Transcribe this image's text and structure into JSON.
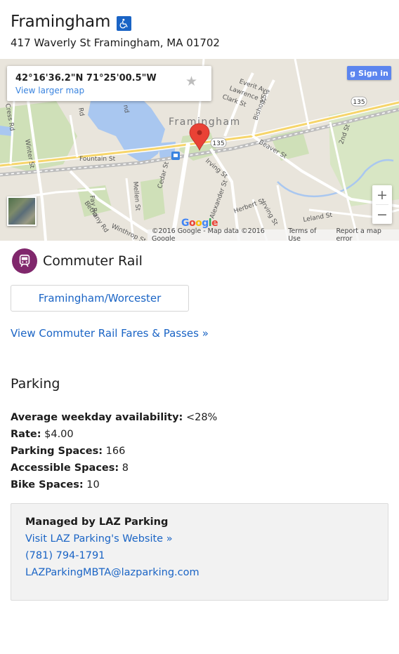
{
  "header": {
    "title": "Framingham",
    "address": "417 Waverly St Framingham, MA 01702"
  },
  "map": {
    "coordinates": "42°16'36.2\"N 71°25'00.5\"W",
    "view_larger": "View larger map",
    "sign_in": "Sign in",
    "zoom_in": "+",
    "zoom_out": "−",
    "google_logo": "Google",
    "attribution": "©2016 Google - Map data ©2016 Google",
    "terms": "Terms of Use",
    "report": "Report a map error",
    "labels": {
      "framingham": "Framingham",
      "everit": "Everit Ave",
      "lawrence": "Lawrence St",
      "clark": "Clark St",
      "bishop": "Bishop St",
      "beaver": "Beaver St",
      "second": "2nd St",
      "irving": "Irving St",
      "irving2": "Irving St",
      "alexander": "Alexander St",
      "herbert": "Herbert St",
      "leland": "Leland St",
      "mellen": "Mellen St",
      "cedar": "Cedar St",
      "fountain": "Fountain St",
      "winter": "Winter St",
      "cresr": "Cress Rd",
      "fay": "Fay Rd",
      "bethany": "Bethany Rd",
      "winthrop": "Winthrop St",
      "rd": "Rd",
      "nd": "nd",
      "r135a": "135",
      "r135b": "135"
    }
  },
  "commuter_rail": {
    "label": "Commuter Rail",
    "line": "Framingham/Worcester",
    "fares_link": "View Commuter Rail Fares & Passes »"
  },
  "parking": {
    "title": "Parking",
    "availability_label": "Average weekday availability:",
    "availability_value": "<28%",
    "rate_label": "Rate:",
    "rate_value": "$4.00",
    "spaces_label": "Parking Spaces:",
    "spaces_value": "166",
    "accessible_label": "Accessible Spaces:",
    "accessible_value": "8",
    "bike_label": "Bike Spaces:",
    "bike_value": "10",
    "managed_by": "Managed by LAZ Parking",
    "website": "Visit LAZ Parking's Website »",
    "phone": "(781) 794-1791",
    "email": "LAZParkingMBTA@lazparking.com"
  },
  "colors": {
    "link": "#1a64c5",
    "rail": "#80276c",
    "accessibility": "#1a64c5",
    "marker": "#e94235"
  }
}
